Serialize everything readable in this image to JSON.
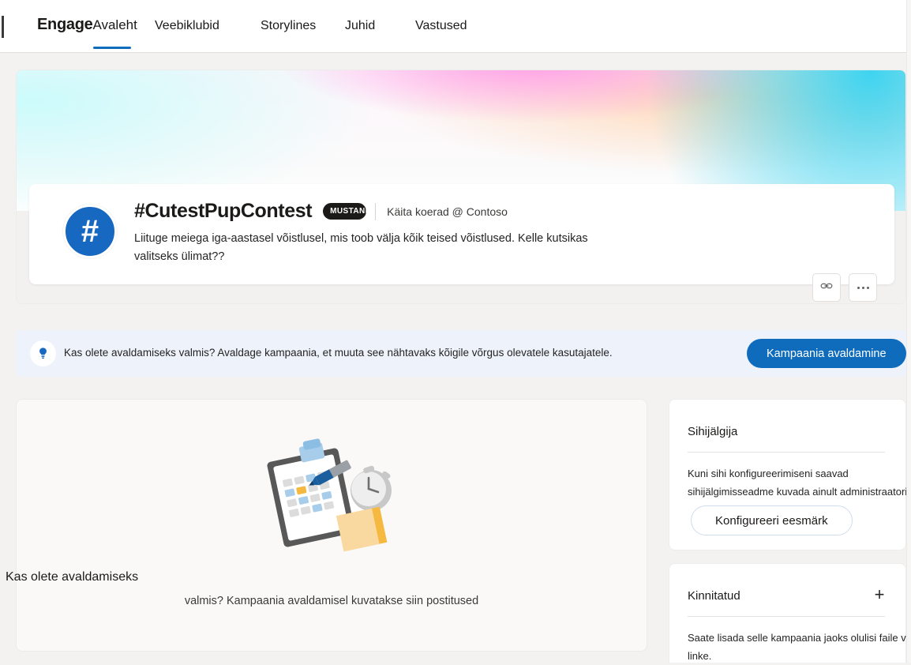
{
  "nav": {
    "brand": "Engage",
    "brand_tab": "Avaleht",
    "items": [
      {
        "label": "Veebiklubid"
      },
      {
        "label": "Storylines"
      },
      {
        "label": "Juhid"
      },
      {
        "label": "Vastused"
      }
    ],
    "active_accent": "#0f6cbd"
  },
  "hero": {
    "avatar_glyph": "#",
    "avatar_color": "#1668c1",
    "title": "#CutestPupContest",
    "status_badge": "MUSTAND",
    "owner": "Käita koerad @ Contoso",
    "description": "Liituge meiega iga-aastasel võistlusel, mis toob välja kõik teised võistlused. Kelle kutsikas valitseks ülimat??",
    "actions": {
      "link": "link-icon",
      "more": "more-options-icon"
    }
  },
  "publish": {
    "icon": "lightbulb-icon",
    "message": "Kas olete avaldamiseks valmis? Avaldage kampaania, et muuta see nähtavaks kõigile võrgus olevatele kasutajatele.",
    "button_label": "Kampaania avaldamine",
    "button_color": "#0f6cbd"
  },
  "feed": {
    "illustration": "clipboard-stopwatch-illustration",
    "empty_line_1": "Kas olete avaldamiseks",
    "empty_line_2": "valmis? Kampaania avaldamisel kuvatakse siin postitused"
  },
  "rail": {
    "target": {
      "heading": "Sihijälgija",
      "body": "Kuni sihi konfigureerimiseni saavad sihijälgimisseadme kuvada ainult administraatorid",
      "button_label": "Konfigureeri eesmärk"
    },
    "approved": {
      "heading": "Kinnitatud",
      "add_icon": "plus-icon",
      "body": "Saate lisada selle kampaania jaoks olulisi faile või linke."
    }
  }
}
